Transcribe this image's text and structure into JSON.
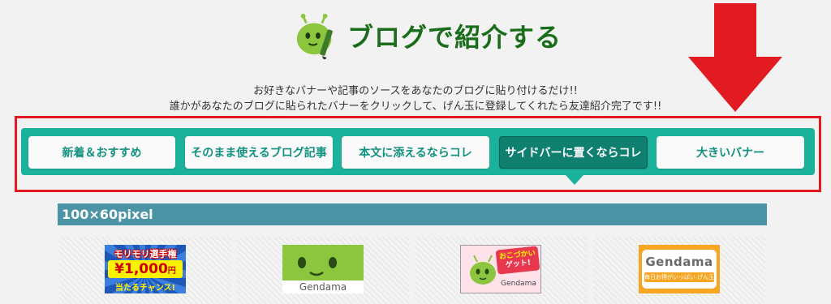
{
  "header": {
    "title": "ブログで紹介する",
    "logo_icon": "mascot-with-pencil-icon"
  },
  "description": {
    "line1": "お好きなバナーや記事のソースをあなたのブログに貼り付けるだけ!!",
    "line2": "誰かがあなたのブログに貼られたバナーをクリックして、げん玉に登録してくれたら友達紹介完了です!!"
  },
  "tabs": [
    {
      "label": "新着＆おすすめ",
      "active": false
    },
    {
      "label": "そのまま使えるブログ記事",
      "active": false
    },
    {
      "label": "本文に添えるならコレ",
      "active": false
    },
    {
      "label": "サイドバーに置くならコレ",
      "active": true
    },
    {
      "label": "大きいバナー",
      "active": false
    }
  ],
  "section": {
    "title": "100×60pixel"
  },
  "banners": [
    {
      "name": "morimori-banner",
      "line1": "モリモリ選手権",
      "line2": "¥1,000",
      "line2_unit": "円",
      "line3": "当たるチャンス!"
    },
    {
      "name": "gendama-mascot-banner",
      "brand": "Gendama"
    },
    {
      "name": "okozukai-banner",
      "line1": "おこづかい",
      "line2": "ゲット!",
      "brand": "Gendama"
    },
    {
      "name": "gendama-logo-banner",
      "brand": "Gendama",
      "tagline": "毎日お得がいっぱい げん玉"
    }
  ],
  "colors": {
    "brand_green": "#1a6d1a",
    "tab_bar": "#1bb29c",
    "tab_text": "#11917f",
    "tab_active": "#0f7f70",
    "section_header": "#4a94a6",
    "highlight_red": "#e21b23"
  },
  "annotation_icon": "red-down-arrow-icon"
}
